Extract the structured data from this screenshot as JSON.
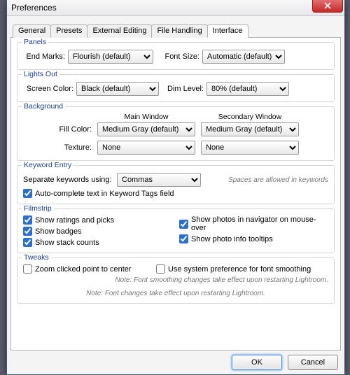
{
  "window": {
    "title": "Preferences"
  },
  "tabs": [
    "General",
    "Presets",
    "External Editing",
    "File Handling",
    "Interface"
  ],
  "active_tab": 4,
  "panels": {
    "title": "Panels",
    "end_marks_label": "End Marks:",
    "end_marks_value": "Flourish (default)",
    "font_size_label": "Font Size:",
    "font_size_value": "Automatic (default)"
  },
  "lights_out": {
    "title": "Lights Out",
    "screen_color_label": "Screen Color:",
    "screen_color_value": "Black (default)",
    "dim_level_label": "Dim Level:",
    "dim_level_value": "80% (default)"
  },
  "background": {
    "title": "Background",
    "main_window": "Main Window",
    "secondary_window": "Secondary Window",
    "fill_color_label": "Fill Color:",
    "fill_color_main": "Medium Gray (default)",
    "fill_color_secondary": "Medium Gray (default)",
    "texture_label": "Texture:",
    "texture_main": "None",
    "texture_secondary": "None"
  },
  "keyword_entry": {
    "title": "Keyword Entry",
    "separate_label": "Separate keywords using:",
    "separate_value": "Commas",
    "hint": "Spaces are allowed in keywords",
    "autocomplete_label": "Auto-complete text in Keyword Tags field"
  },
  "filmstrip": {
    "title": "Filmstrip",
    "show_ratings": "Show ratings and picks",
    "show_badges": "Show badges",
    "show_stack": "Show stack counts",
    "show_nav": "Show photos in navigator on mouse-over",
    "show_tooltips": "Show photo info tooltips"
  },
  "tweaks": {
    "title": "Tweaks",
    "zoom_label": "Zoom clicked point to center",
    "font_smooth_label": "Use system preference for font smoothing",
    "note1": "Note: Font smoothing changes take effect upon restarting Lightroom.",
    "note2": "Note: Font changes take effect upon restarting Lightroom."
  },
  "buttons": {
    "ok": "OK",
    "cancel": "Cancel"
  }
}
